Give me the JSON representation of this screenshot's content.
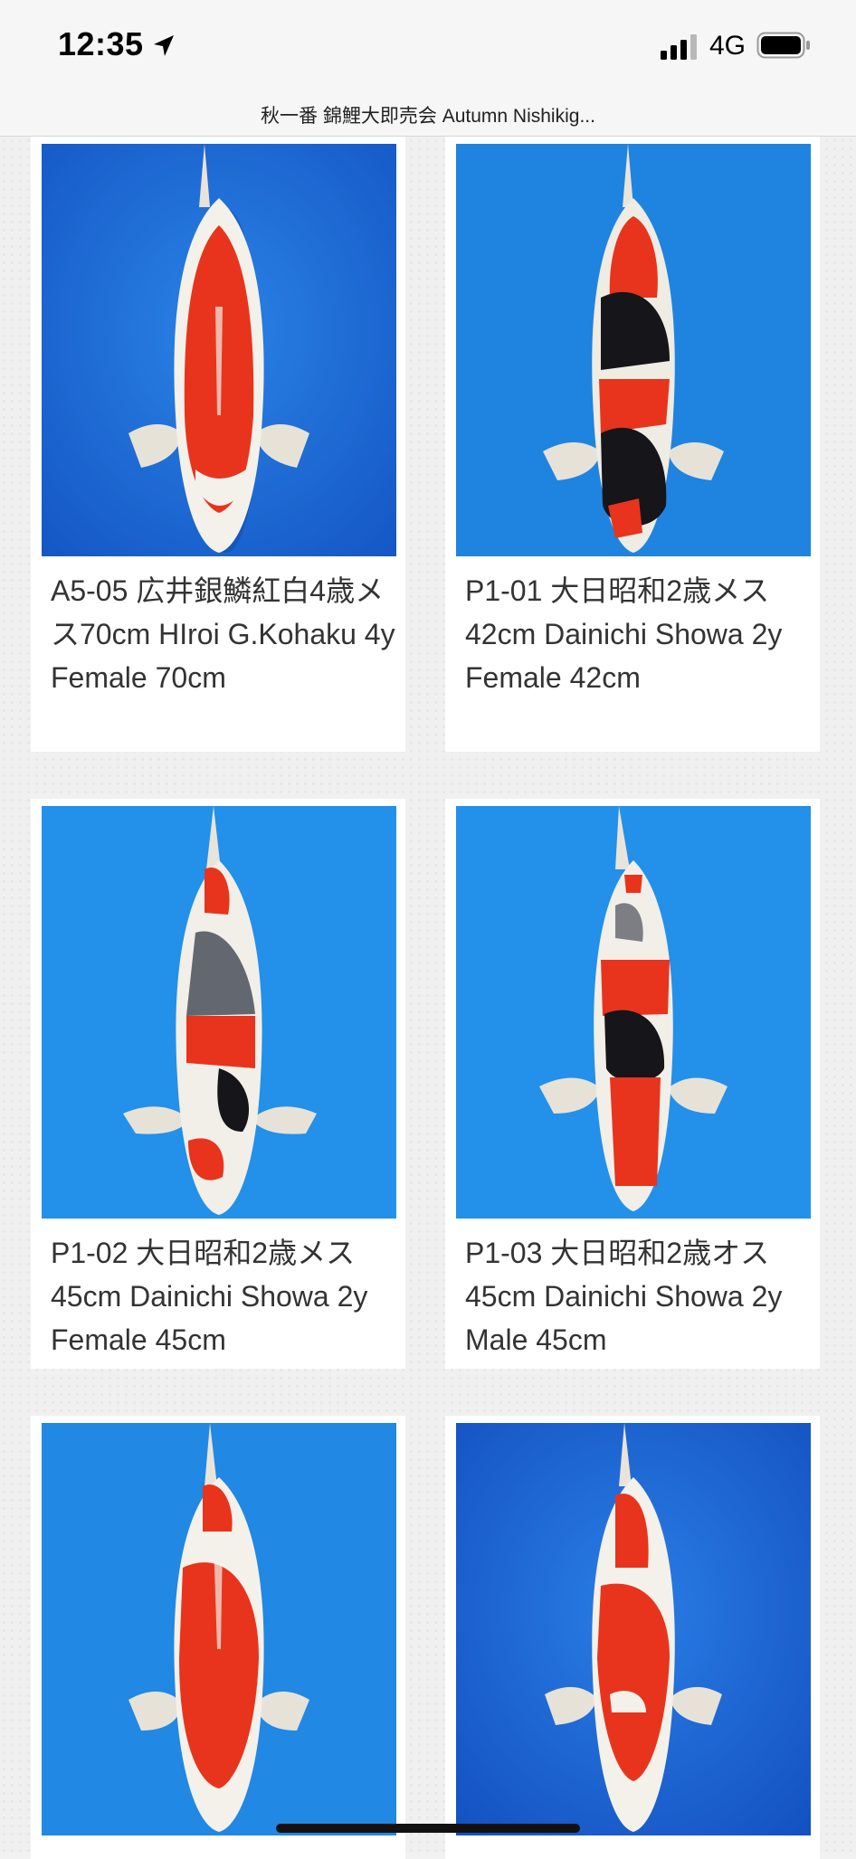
{
  "status_bar": {
    "time": "12:35",
    "network": "4G"
  },
  "header": {
    "title": "秋一番 錦鯉大即売会 Autumn Nishikig..."
  },
  "listings": [
    {
      "caption": "A5-05 広井銀鱗紅白4歳メス70cm HIroi G.Kohaku 4y Female 70cm",
      "variety": "kohaku"
    },
    {
      "caption": "P1-01 大日昭和2歳メス 42cm Dainichi Showa 2y Female 42cm",
      "variety": "showa"
    },
    {
      "caption": "P1-02 大日昭和2歳メス 45cm Dainichi Showa 2y Female 45cm",
      "variety": "showa"
    },
    {
      "caption": "P1-03 大日昭和2歳オス 45cm Dainichi Showa 2y Male 45cm",
      "variety": "showa"
    },
    {
      "caption": "",
      "variety": "kohaku"
    },
    {
      "caption": "",
      "variety": "kohaku"
    }
  ],
  "colors": {
    "water_blue": "#1f7fd8",
    "koi_red": "#e8341c",
    "koi_white": "#f4f1ea",
    "koi_black": "#15151a"
  }
}
